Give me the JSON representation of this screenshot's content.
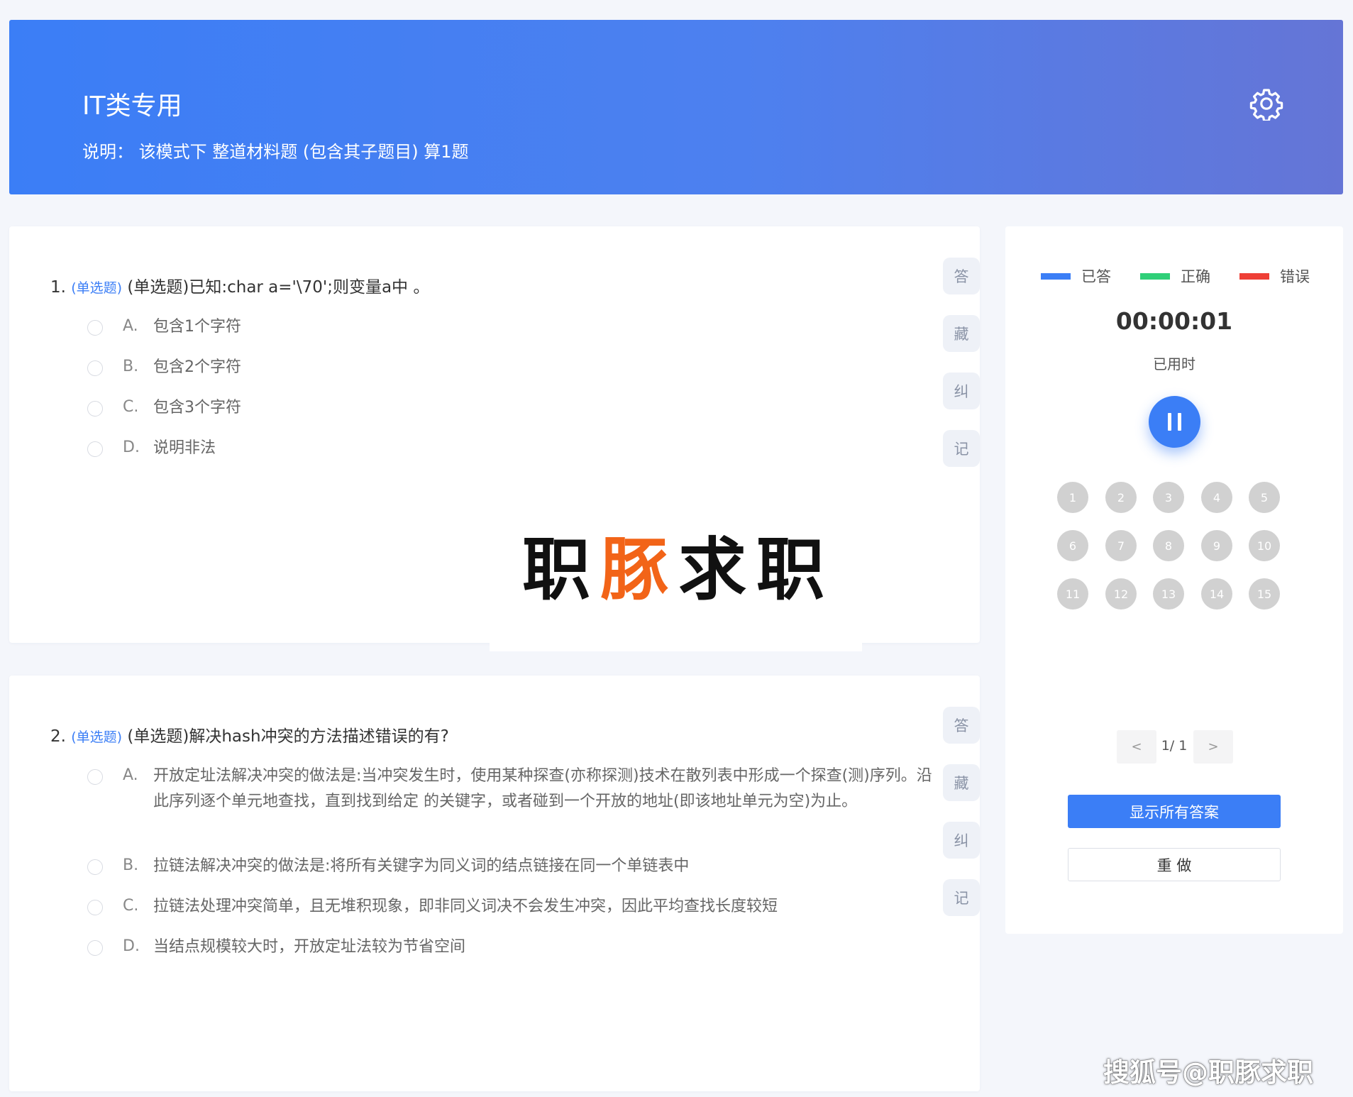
{
  "header": {
    "title": "IT类专用",
    "description": "说明：  该模式下 整道材料题 (包含其子题目) 算1题",
    "settings_icon": "gear-icon"
  },
  "side_actions": [
    "答",
    "藏",
    "纠",
    "记"
  ],
  "questions": [
    {
      "number": "1.",
      "type_tag": "(单选题)",
      "text": "(单选题)已知:char a='\\70';则变量a中 。",
      "options": [
        {
          "letter": "A.",
          "text": "包含1个字符"
        },
        {
          "letter": "B.",
          "text": "包含2个字符"
        },
        {
          "letter": "C.",
          "text": "包含3个字符"
        },
        {
          "letter": "D.",
          "text": "说明非法"
        }
      ]
    },
    {
      "number": "2.",
      "type_tag": "(单选题)",
      "text": "(单选题)解决hash冲突的方法描述错误的有?",
      "options": [
        {
          "letter": "A.",
          "text": "开放定址法解决冲突的做法是:当冲突发生时，使用某种探查(亦称探测)技术在散列表中形成一个探查(测)序列。沿此序列逐个单元地查找，直到找到给定 的关键字，或者碰到一个开放的地址(即该地址单元为空)为止。"
        },
        {
          "letter": "B.",
          "text": "拉链法解决冲突的做法是:将所有关键字为同义词的结点链接在同一个单链表中"
        },
        {
          "letter": "C.",
          "text": "拉链法处理冲突简单，且无堆积现象，即非同义词决不会发生冲突，因此平均查找长度较短"
        },
        {
          "letter": "D.",
          "text": "当结点规模较大时，开放定址法较为节省空间"
        }
      ]
    }
  ],
  "logo": {
    "part1": "职",
    "part2": "豚",
    "part3": "求职"
  },
  "panel": {
    "legend": [
      {
        "label": "已答",
        "color": "#3b7ef6"
      },
      {
        "label": "正确",
        "color": "#2fcf78"
      },
      {
        "label": "错误",
        "color": "#ee3f36"
      }
    ],
    "timer": "00:00:01",
    "timer_label": "已用时",
    "question_numbers": [
      "1",
      "2",
      "3",
      "4",
      "5",
      "6",
      "7",
      "8",
      "9",
      "10",
      "11",
      "12",
      "13",
      "14",
      "15"
    ],
    "pager": {
      "prev": "<",
      "next": ">",
      "text": "1/ 1"
    },
    "show_answers_label": "显示所有答案",
    "redo_label": "重 做"
  },
  "watermark": "搜狐号@职豚求职"
}
